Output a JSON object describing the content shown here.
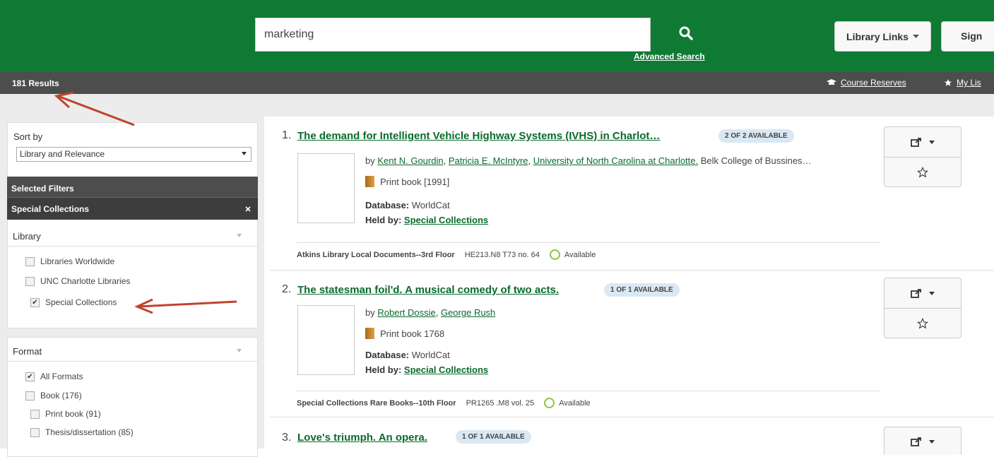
{
  "header": {
    "search_value": "marketing",
    "advanced_search": "Advanced Search",
    "library_links": "Library Links",
    "sign_in": "Sign"
  },
  "subbar": {
    "results_count": "181 Results",
    "course_reserves": "Course Reserves",
    "my_lists": "My Lis"
  },
  "sidebar": {
    "sort_label": "Sort by",
    "sort_value": "Library and Relevance",
    "selected_filters_label": "Selected Filters",
    "active_filter": "Special Collections",
    "library_label": "Library",
    "library_options": [
      {
        "label": "Libraries Worldwide",
        "checked": false
      },
      {
        "label": "UNC Charlotte Libraries",
        "checked": false
      },
      {
        "label": "Special Collections",
        "checked": true
      }
    ],
    "format_label": "Format",
    "format_options": [
      {
        "label": "All Formats",
        "checked": true
      },
      {
        "label": "Book (176)",
        "checked": false
      },
      {
        "label": "Print book (91)",
        "checked": false
      },
      {
        "label": "Thesis/dissertation (85)",
        "checked": false
      }
    ]
  },
  "results": [
    {
      "num": "1.",
      "title": "The demand for Intelligent Vehicle Highway Systems (IVHS) in Charlot…",
      "availability": "2 OF 2 AVAILABLE",
      "by": "by",
      "authors": [
        "Kent N. Gourdin",
        "Patricia E. McIntyre",
        "University of North Carolina at Charlotte."
      ],
      "author_extra": "Belk College of Bussines…",
      "format": "Print book [1991]",
      "database_label": "Database:",
      "database_value": "WorldCat",
      "held_label": "Held by:",
      "held_value": "Special Collections",
      "location": "Atkins Library Local Documents--3rd Floor",
      "call_number": "HE213.N8 T73 no. 64",
      "status": "Available"
    },
    {
      "num": "2.",
      "title": "The statesman foil'd. A musical comedy of two acts.",
      "availability": "1 OF 1 AVAILABLE",
      "by": "by",
      "authors": [
        "Robert Dossie",
        "George Rush"
      ],
      "author_extra": "",
      "format": "Print book 1768",
      "database_label": "Database:",
      "database_value": "WorldCat",
      "held_label": "Held by:",
      "held_value": "Special Collections",
      "location": "Special Collections Rare Books--10th Floor",
      "call_number": "PR1265 .M8 vol. 25",
      "status": "Available"
    },
    {
      "num": "3.",
      "title": "Love's triumph. An opera.",
      "availability": "1 OF 1 AVAILABLE"
    }
  ],
  "icons": {
    "search": "search-icon",
    "caret": "caret-down-icon",
    "share": "share-icon",
    "star": "star-outline-icon",
    "book": "book-icon",
    "graduation": "graduation-cap-icon",
    "list_star": "star-icon",
    "close": "close-icon"
  },
  "colors": {
    "brand_green": "#0f7a33",
    "link_green": "#0a6b2c",
    "dark_bar": "#4d4d4d",
    "badge_bg": "#d9e8f3",
    "available_ring": "#8dc63f",
    "annotation_arrow": "#c0432d"
  }
}
